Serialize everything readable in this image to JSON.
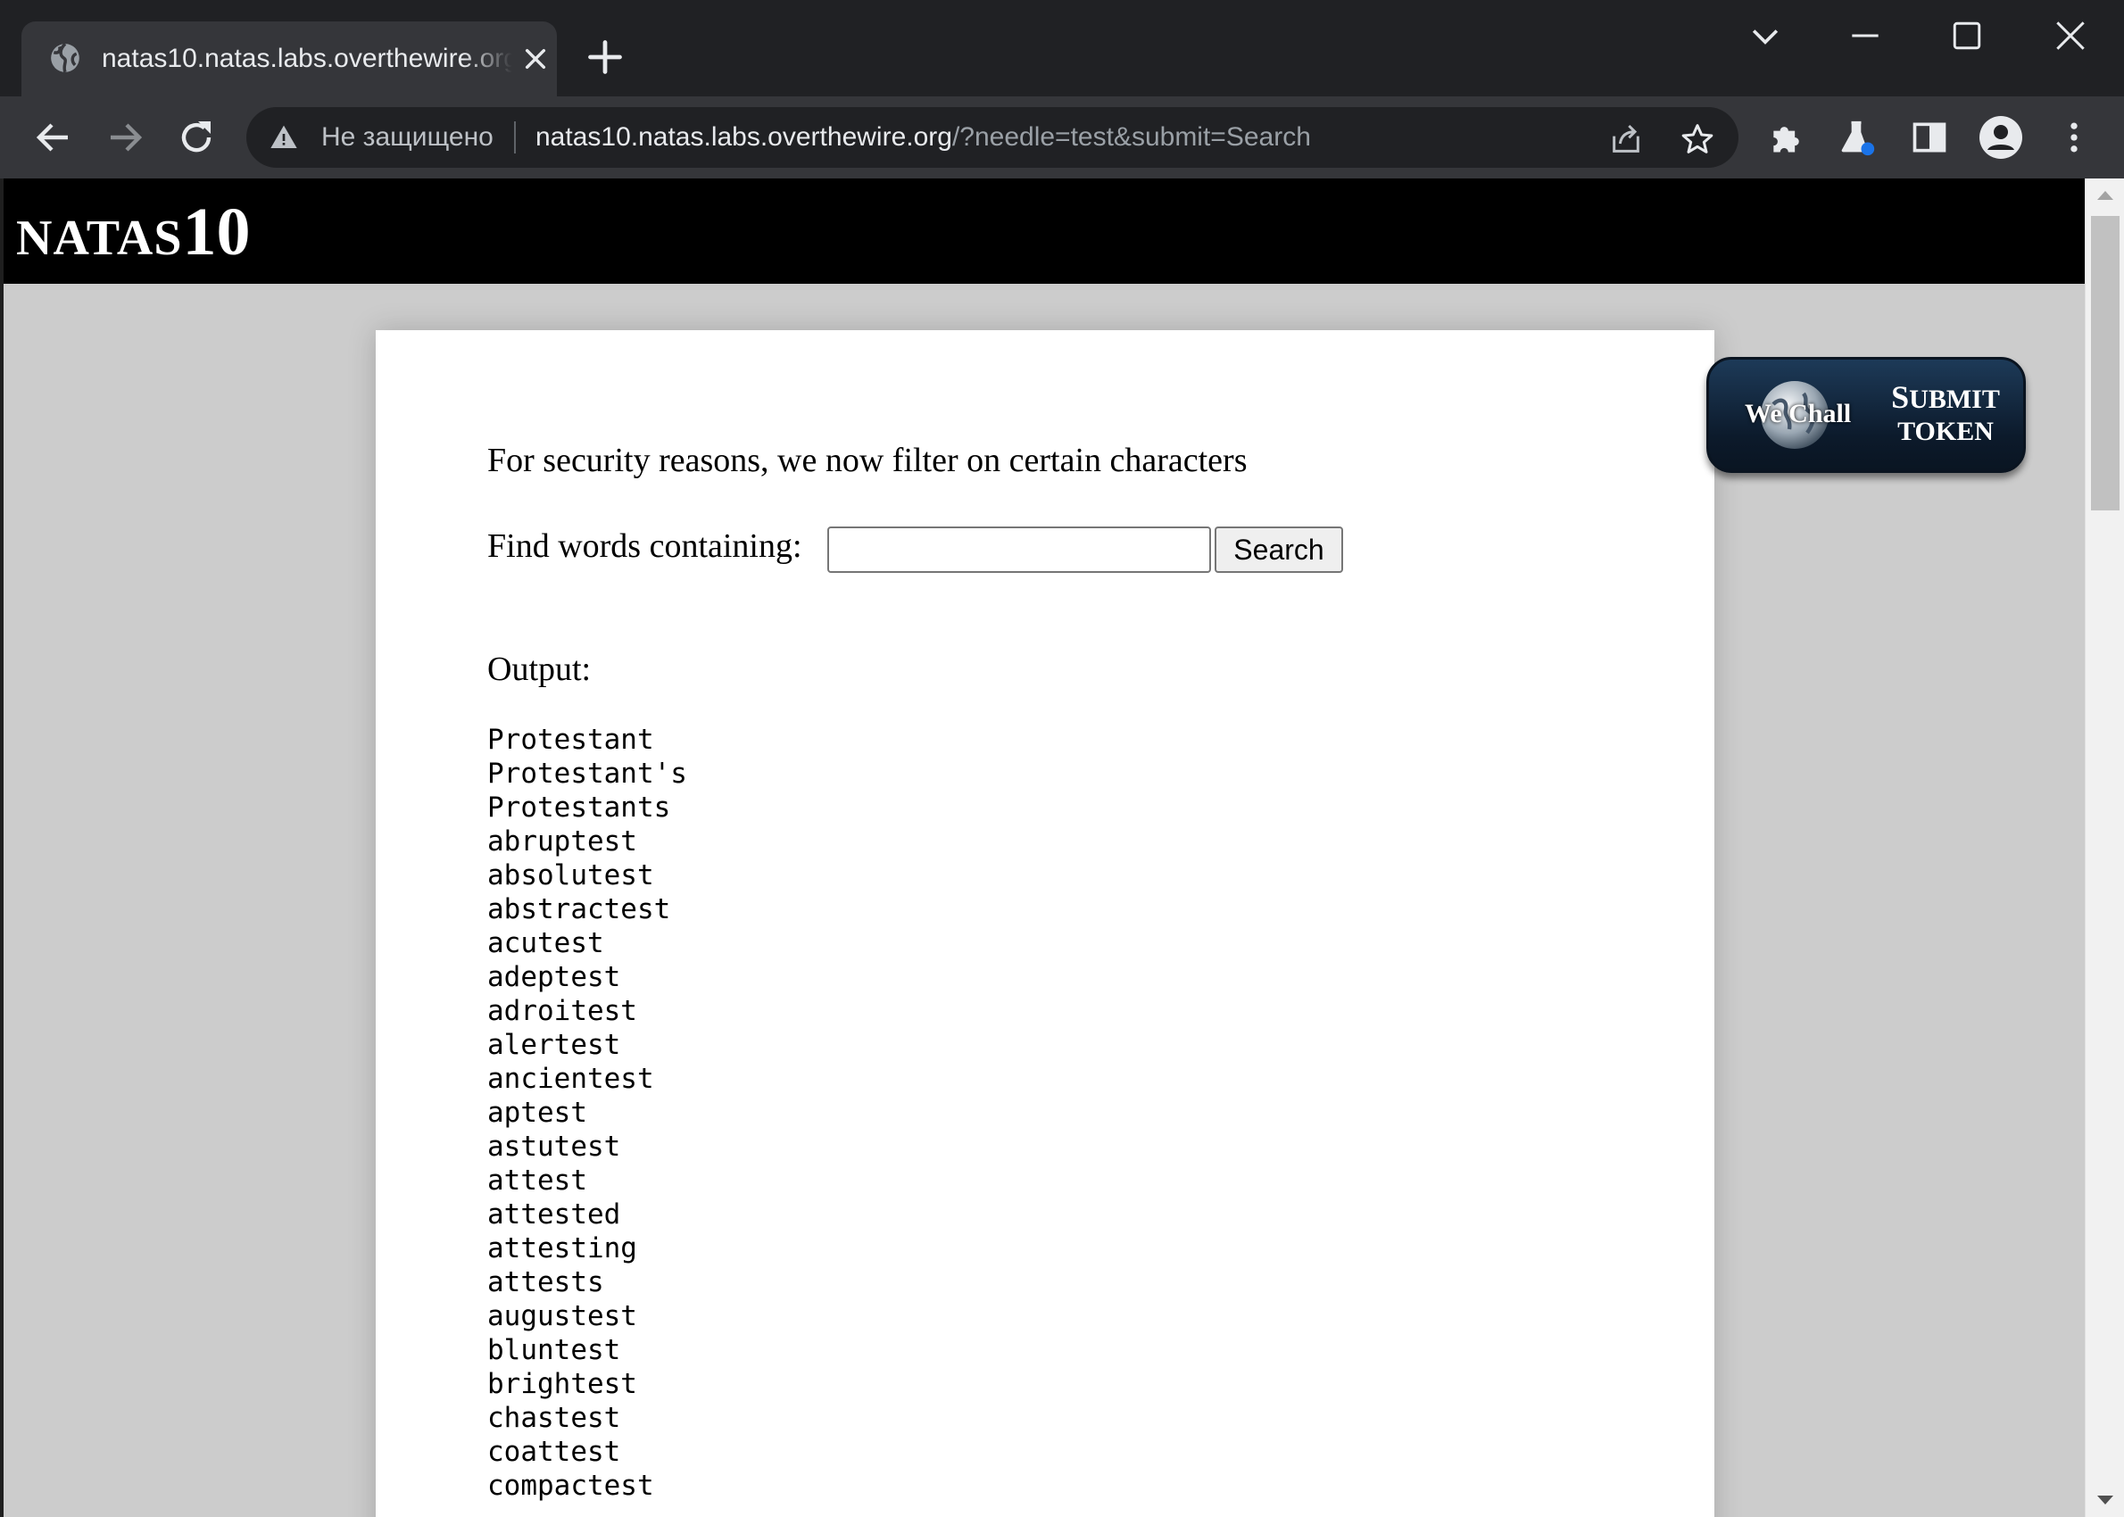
{
  "browser": {
    "tab_title": "natas10.natas.labs.overthewire.org",
    "security_label": "Не защищено",
    "url_host": "natas10.natas.labs.overthewire.org",
    "url_path": "/?needle=test&submit=Search"
  },
  "page": {
    "logo_prefix": "NATAS",
    "logo_number": "10",
    "intro_text": "For security reasons, we now filter on certain characters",
    "find_label": "Find words containing:",
    "search_value": "",
    "search_button": "Search",
    "output_label": "Output:",
    "output_words": [
      "Protestant",
      "Protestant's",
      "Protestants",
      "abruptest",
      "absolutest",
      "abstractest",
      "acutest",
      "adeptest",
      "adroitest",
      "alertest",
      "ancientest",
      "aptest",
      "astutest",
      "attest",
      "attested",
      "attesting",
      "attests",
      "augustest",
      "bluntest",
      "brightest",
      "chastest",
      "coattest",
      "compactest"
    ]
  },
  "wechall": {
    "brand": "We Chall",
    "submit_first": "S",
    "submit_rest": "UBMIT",
    "token": "TOKEN"
  },
  "icons": {
    "tab_favicon": "globe-icon",
    "tab_close": "close-icon",
    "new_tab": "plus-icon",
    "tab_search": "chevron-down-icon",
    "minimize": "minimize-icon",
    "maximize": "maximize-icon",
    "close_window": "close-icon",
    "back": "arrow-left-icon",
    "forward": "arrow-right-icon",
    "reload": "reload-icon",
    "not_secure": "warning-icon",
    "share": "share-icon",
    "bookmark": "star-icon",
    "extensions": "puzzle-icon",
    "labs": "flask-icon",
    "side_panel": "side-panel-icon",
    "profile": "profile-icon",
    "menu": "more-vertical-icon"
  },
  "colors": {
    "chrome_dark": "#202124",
    "chrome_toolbar": "#35363a",
    "page_background": "#cccccc",
    "header_background": "#000000",
    "lab_badge": "#1a73e8"
  }
}
